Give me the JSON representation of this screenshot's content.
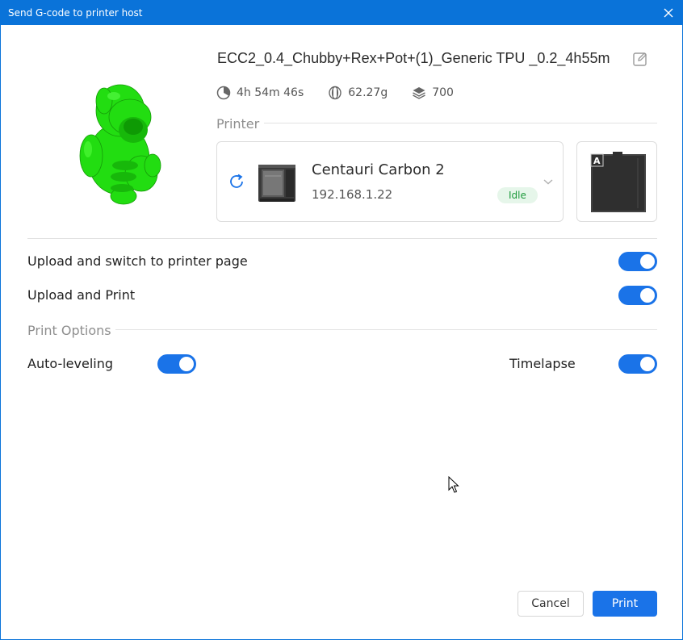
{
  "window": {
    "title": "Send G-code to printer host"
  },
  "file": {
    "name": "ECC2_0.4_Chubby+Rex+Pot+(1)_Generic TPU _0.2_4h55m",
    "print_time": "4h 54m 46s",
    "weight": "62.27g",
    "layers": "700"
  },
  "printer_section": {
    "label": "Printer",
    "printer_name": "Centauri Carbon 2",
    "printer_ip": "192.168.1.22",
    "status": "Idle",
    "plate_badge": "A"
  },
  "options": {
    "upload_switch_label": "Upload and switch to printer page",
    "upload_switch_on": true,
    "upload_print_label": "Upload and Print",
    "upload_print_on": true
  },
  "print_options": {
    "label": "Print Options",
    "auto_leveling_label": "Auto-leveling",
    "auto_leveling_on": true,
    "timelapse_label": "Timelapse",
    "timelapse_on": true
  },
  "buttons": {
    "cancel": "Cancel",
    "print": "Print"
  },
  "colors": {
    "accent": "#1a73e8",
    "titlebar": "#0a73d9",
    "model": "#22dd11",
    "idle_bg": "#e6f6ea",
    "idle_text": "#1e9a3c"
  }
}
